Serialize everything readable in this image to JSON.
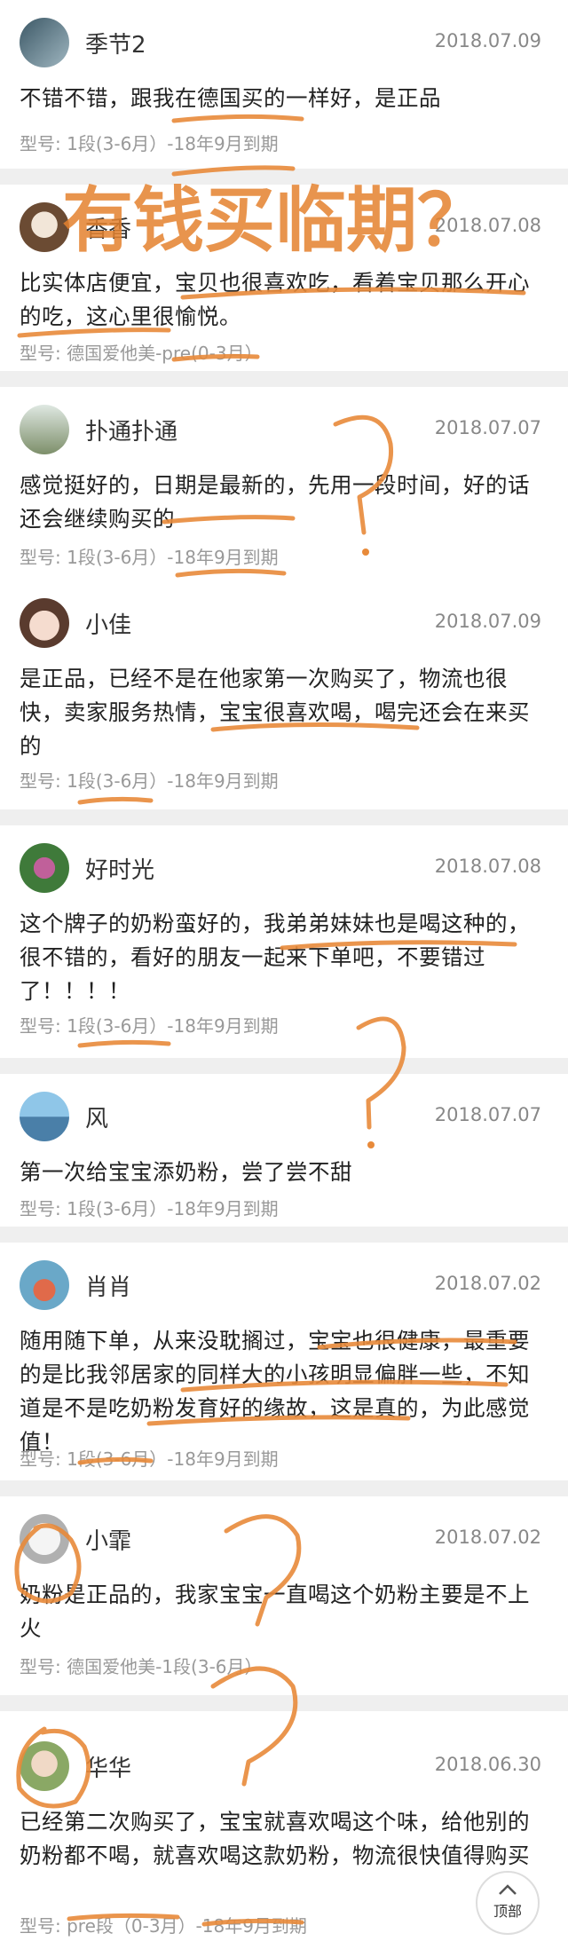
{
  "reviews": [
    {
      "user": "季节2",
      "date": "2018.07.09",
      "text": "不错不错，跟我在德国买的一样好，是正品",
      "model": "型号: 1段(3-6月）-18年9月到期",
      "avatar_icon": "user-avatar-icon",
      "avatar_color": "#5a7b8a"
    },
    {
      "user": "香香",
      "date": "2018.07.08",
      "text": "比实体店便宜，宝贝也很喜欢吃，看着宝贝那么开心的吃，这心里很愉悦。",
      "model": "型号: 德国爱他美-pre(0-3月）",
      "avatar_icon": "dog-avatar-icon",
      "avatar_color": "#8a6b52"
    },
    {
      "user": "扑通扑通",
      "date": "2018.07.07",
      "text": "感觉挺好的，日期是最新的，先用一段时间，好的话还会继续购买的",
      "model": "型号: 1段(3-6月）-18年9月到期",
      "avatar_icon": "person-avatar-icon",
      "avatar_color": "#7d8f6a"
    },
    {
      "user": "小佳",
      "date": "2018.07.09",
      "text": "是正品，已经不是在他家第一次购买了，物流也很快，卖家服务热情，宝宝很喜欢喝，喝完还会在来买的",
      "model": "型号: 1段(3-6月）-18年9月到期",
      "avatar_icon": "girl-avatar-icon",
      "avatar_color": "#d9b8a8"
    },
    {
      "user": "好时光",
      "date": "2018.07.08",
      "text": "这个牌子的奶粉蛮好的，我弟弟妹妹也是喝这种的，很不错的，看好的朋友一起来下单吧，不要错过了！！！！",
      "model": "型号: 1段(3-6月）-18年9月到期",
      "avatar_icon": "flower-avatar-icon",
      "avatar_color": "#7a4a6a"
    },
    {
      "user": "风",
      "date": "2018.07.07",
      "text": "第一次给宝宝添奶粉，尝了尝不甜",
      "model": "型号: 1段(3-6月）-18年9月到期",
      "avatar_icon": "landscape-avatar-icon",
      "avatar_color": "#4a7fa8"
    },
    {
      "user": "肖肖",
      "date": "2018.07.02",
      "text": "随用随下单，从来没耽搁过，宝宝也很健康，最重要的是比我邻居家的同样大的小孩明显偏胖一些，不知道是不是吃奶粉发育好的缘故，这是真的，为此感觉值！",
      "model": "型号: 1段(3-6月）-18年9月到期",
      "avatar_icon": "toy-avatar-icon",
      "avatar_color": "#6aa8c8"
    },
    {
      "user": "小霏",
      "date": "2018.07.02",
      "text": "奶粉是正品的，我家宝宝一直喝这个奶粉主要是不上火",
      "model": "型号: 德国爱他美-1段(3-6月）",
      "avatar_icon": "cat-avatar-icon",
      "avatar_color": "#c8c8c8"
    },
    {
      "user": "华华",
      "date": "2018.06.30",
      "text": "已经第二次购买了，宝宝就喜欢喝这个味，给他别的奶粉都不喝，就喜欢喝这款奶粉，物流很快值得购买",
      "model": "型号: pre段（0-3月）-18年9月到期",
      "avatar_icon": "baby-avatar-icon",
      "avatar_color": "#9ab27a"
    }
  ],
  "annotation": {
    "handwritten_text": "有钱买临期？",
    "question_mark": "?",
    "color": "#e88a3a"
  },
  "back_to_top": {
    "label": "顶部",
    "icon": "chevron-up-icon"
  }
}
